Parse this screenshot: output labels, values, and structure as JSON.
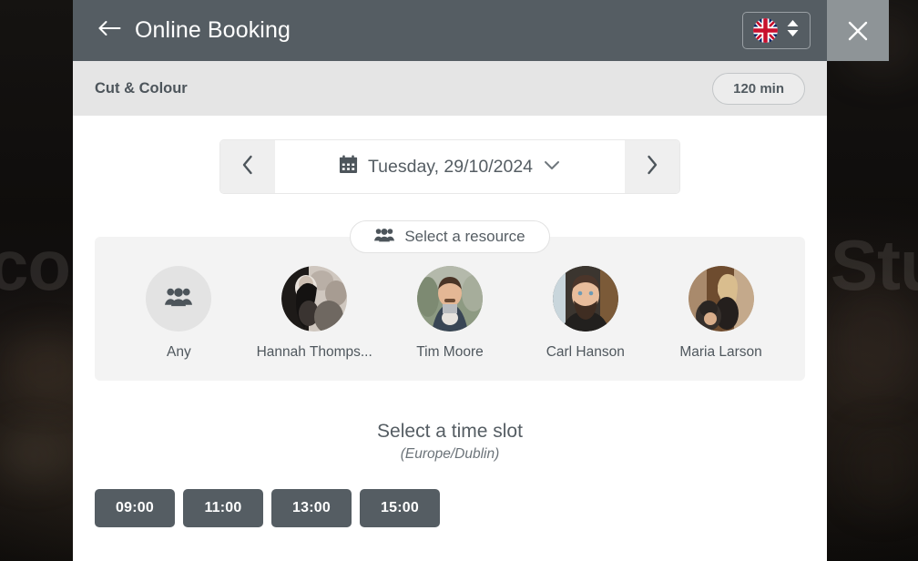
{
  "background": {
    "left_text": "con",
    "right_text": "Stu"
  },
  "close_button": {
    "icon": "close-icon",
    "label": "Close"
  },
  "header": {
    "back_icon": "arrow-left-icon",
    "title": "Online Booking",
    "language": {
      "flag": "uk-flag-icon",
      "stepper_icon": "sort-updown-icon"
    }
  },
  "subheader": {
    "service": "Cut & Colour",
    "duration": "120 min"
  },
  "date_nav": {
    "prev_icon": "chevron-left-icon",
    "next_icon": "chevron-right-icon",
    "calendar_icon": "calendar-icon",
    "date": "Tuesday, 29/10/2024",
    "dropdown_icon": "chevron-down-icon"
  },
  "resource_picker": {
    "pill_icon": "users-icon",
    "pill_label": "Select a resource",
    "resources": [
      {
        "name": "Any",
        "avatar": "users-icon",
        "type": "any"
      },
      {
        "name": "Hannah Thomps...",
        "avatar": "photo",
        "type": "person"
      },
      {
        "name": "Tim Moore",
        "avatar": "photo",
        "type": "person"
      },
      {
        "name": "Carl Hanson",
        "avatar": "photo",
        "type": "person"
      },
      {
        "name": "Maria Larson",
        "avatar": "photo",
        "type": "person"
      }
    ]
  },
  "time_slots": {
    "heading": "Select a time slot",
    "timezone": "(Europe/Dublin)",
    "slots": [
      "09:00",
      "11:00",
      "13:00",
      "15:00"
    ]
  },
  "colors": {
    "header_bg": "#555d63",
    "subheader_bg": "#e5e5e5",
    "panel_bg": "#f3f3f3",
    "slot_bg": "#555d63",
    "close_bg": "#8e9497"
  }
}
